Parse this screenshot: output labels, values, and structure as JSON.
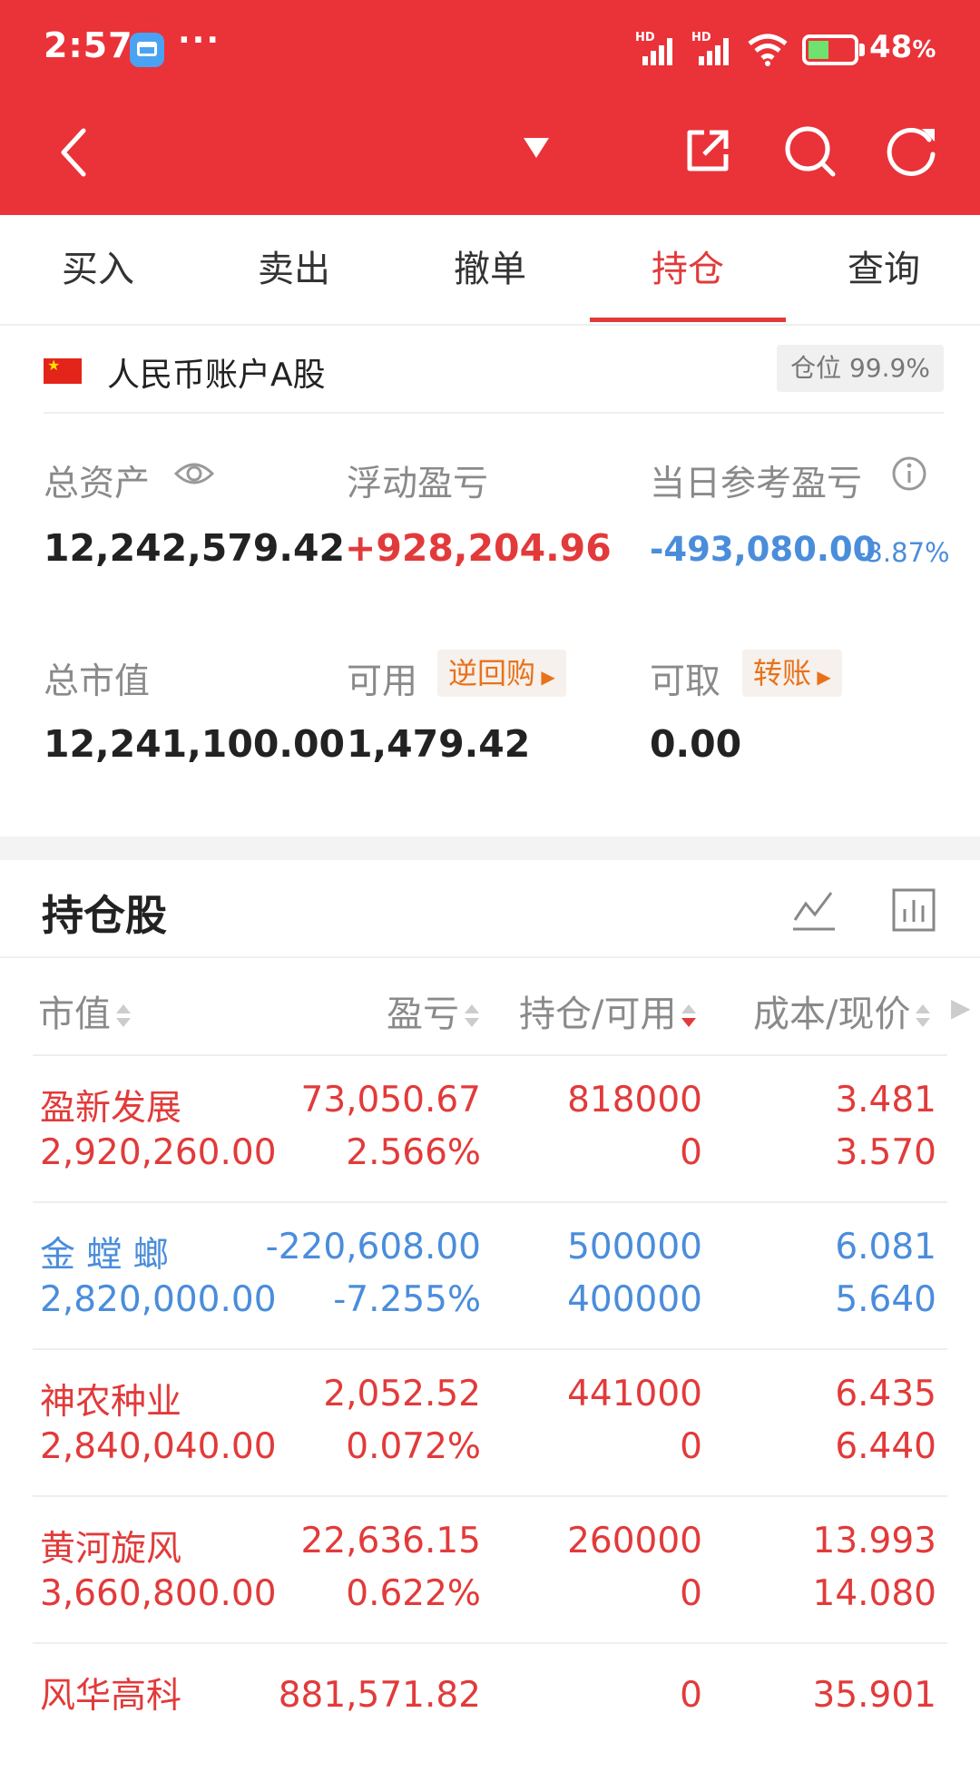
{
  "status_bar": {
    "time": "2:57",
    "dots": "···",
    "hd1": "HD",
    "hd2": "HD",
    "battery": "48",
    "battery_unit": "%"
  },
  "tabs": [
    "买入",
    "卖出",
    "撤单",
    "持仓",
    "查询"
  ],
  "active_tab": "持仓",
  "account": {
    "name": "人民币账户A股",
    "position_label": "仓位",
    "position_value": "99.9%"
  },
  "summary": {
    "total_assets_label": "总资产",
    "total_assets": "12,242,579.42",
    "floating_pl_label": "浮动盈亏",
    "floating_pl": "+928,204.96",
    "daily_pl_label": "当日参考盈亏",
    "daily_pl": "-493,080.00",
    "daily_pl_pct": "-3.87%",
    "market_value_label": "总市值",
    "market_value": "12,241,100.00",
    "available_label": "可用",
    "repo_button": "逆回购",
    "available": "1,479.42",
    "withdrawable_label": "可取",
    "transfer_button": "转账",
    "withdrawable": "0.00"
  },
  "holdings": {
    "title": "持仓股",
    "headers": {
      "market_value": "市值",
      "pl": "盈亏",
      "holding": "持仓/可用",
      "cost": "成本/现价"
    },
    "rows": [
      {
        "name": "盈新发展",
        "market_value": "2,920,260.00",
        "pl": "73,050.67",
        "pl_pct": "2.566%",
        "holding": "818000",
        "available": "0",
        "cost": "3.481",
        "price": "3.570",
        "color": "#e23a3a"
      },
      {
        "name": "金 螳 螂",
        "market_value": "2,820,000.00",
        "pl": "-220,608.00",
        "pl_pct": "-7.255%",
        "holding": "500000",
        "available": "400000",
        "cost": "6.081",
        "price": "5.640",
        "color": "#4a8ddb"
      },
      {
        "name": "神农种业",
        "market_value": "2,840,040.00",
        "pl": "2,052.52",
        "pl_pct": "0.072%",
        "holding": "441000",
        "available": "0",
        "cost": "6.435",
        "price": "6.440",
        "color": "#e23a3a"
      },
      {
        "name": "黄河旋风",
        "market_value": "3,660,800.00",
        "pl": "22,636.15",
        "pl_pct": "0.622%",
        "holding": "260000",
        "available": "0",
        "cost": "13.993",
        "price": "14.080",
        "color": "#e23a3a"
      },
      {
        "name": "风华高科",
        "market_value": "",
        "pl": "881,571.82",
        "pl_pct": "",
        "holding": "0",
        "available": "",
        "cost": "35.901",
        "price": "",
        "color": "#e23a3a"
      }
    ]
  },
  "colors": {
    "brand_red": "#ea3239",
    "up_red": "#e23a3a",
    "down_blue": "#4a8ddb",
    "pill_orange": "#e8721c"
  }
}
